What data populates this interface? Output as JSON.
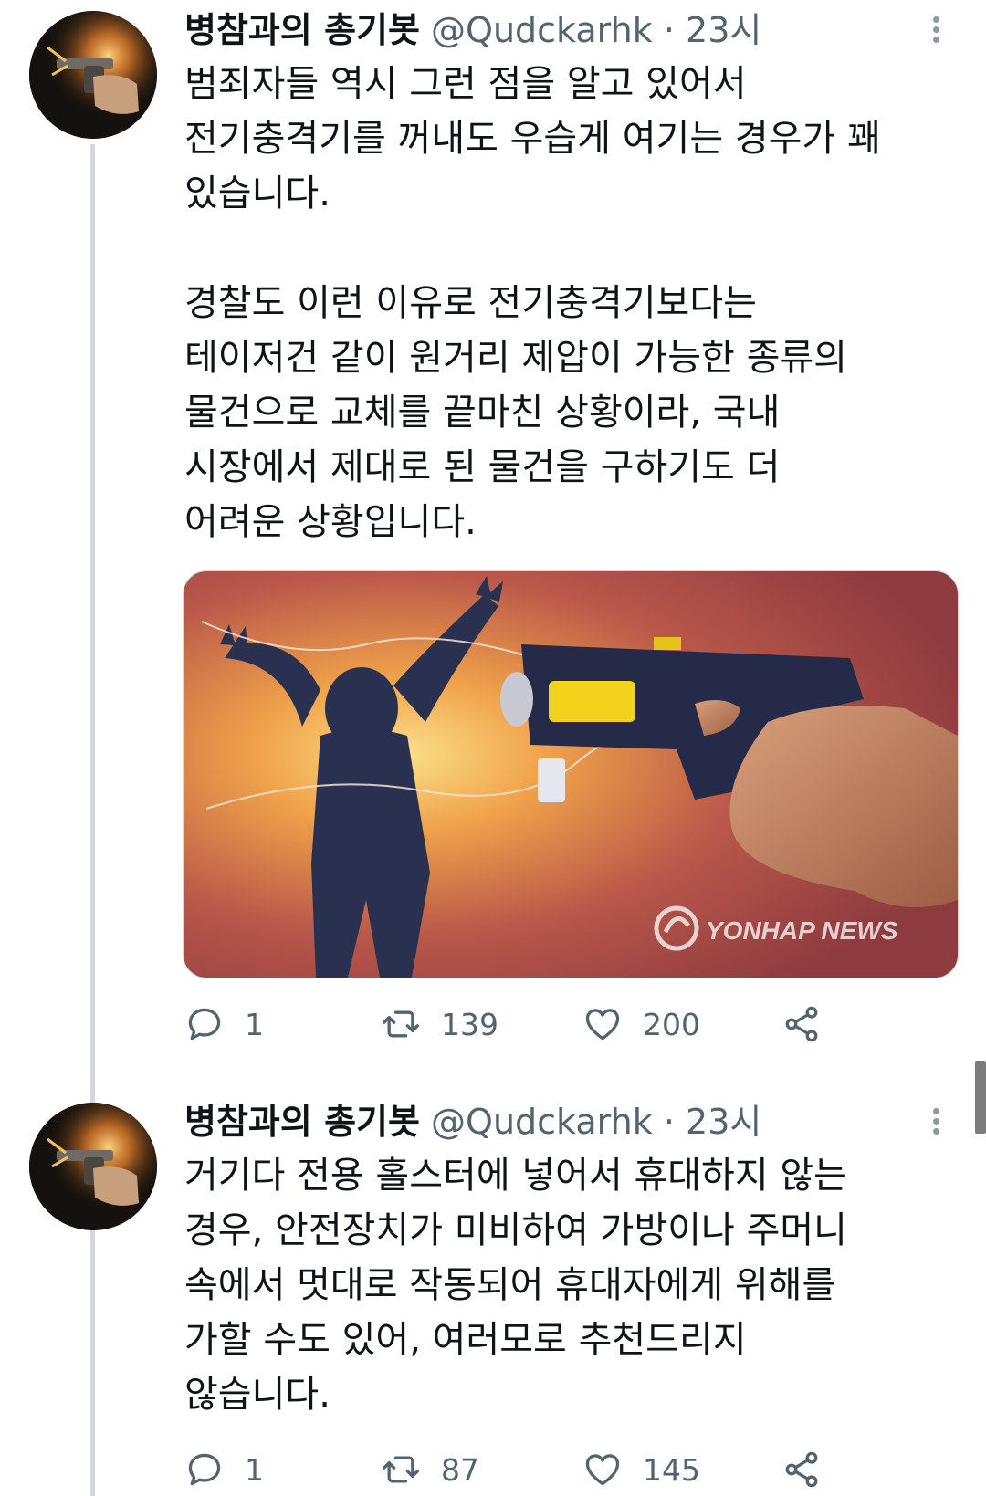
{
  "tweets": [
    {
      "author_name": "병참과의 총기봇",
      "handle": "@Qudckarhk",
      "separator": "·",
      "time": "23시",
      "paragraphs": [
        [
          "범죄자들 역시 그런 점을 알고 있어서",
          "전기충격기를 꺼내도 우습게 여기는 경우가 꽤",
          "있습니다."
        ],
        [
          "경찰도 이런 이유로 전기충격기보다는",
          "테이저건 같이 원거리 제압이 가능한 종류의",
          "물건으로 교체를 끝마친 상황이라, 국내",
          "시장에서 제대로 된 물건을 구하기도 더",
          "어려운 상황입니다."
        ]
      ],
      "media": {
        "watermark": "YONHAP NEWS"
      },
      "stats": {
        "replies": "1",
        "retweets": "139",
        "likes": "200"
      },
      "icons": {
        "reply": "reply-icon",
        "retweet": "retweet-icon",
        "like": "heart-icon",
        "share": "share-icon",
        "more": "more-vertical-icon"
      }
    },
    {
      "author_name": "병참과의 총기봇",
      "handle": "@Qudckarhk",
      "separator": "·",
      "time": "23시",
      "paragraphs": [
        [
          "거기다 전용 홀스터에 넣어서 휴대하지 않는",
          "경우, 안전장치가 미비하여 가방이나 주머니",
          "속에서 멋대로 작동되어 휴대자에게 위해를",
          "가할 수도 있어, 여러모로 추천드리지",
          "않습니다."
        ]
      ],
      "stats": {
        "replies": "1",
        "retweets": "87",
        "likes": "145"
      },
      "icons": {
        "reply": "reply-icon",
        "retweet": "retweet-icon",
        "like": "heart-icon",
        "share": "share-icon",
        "more": "more-vertical-icon"
      }
    }
  ],
  "colors": {
    "text": "#0f1419",
    "secondary": "#536471",
    "thread_line": "#cfd9de"
  }
}
